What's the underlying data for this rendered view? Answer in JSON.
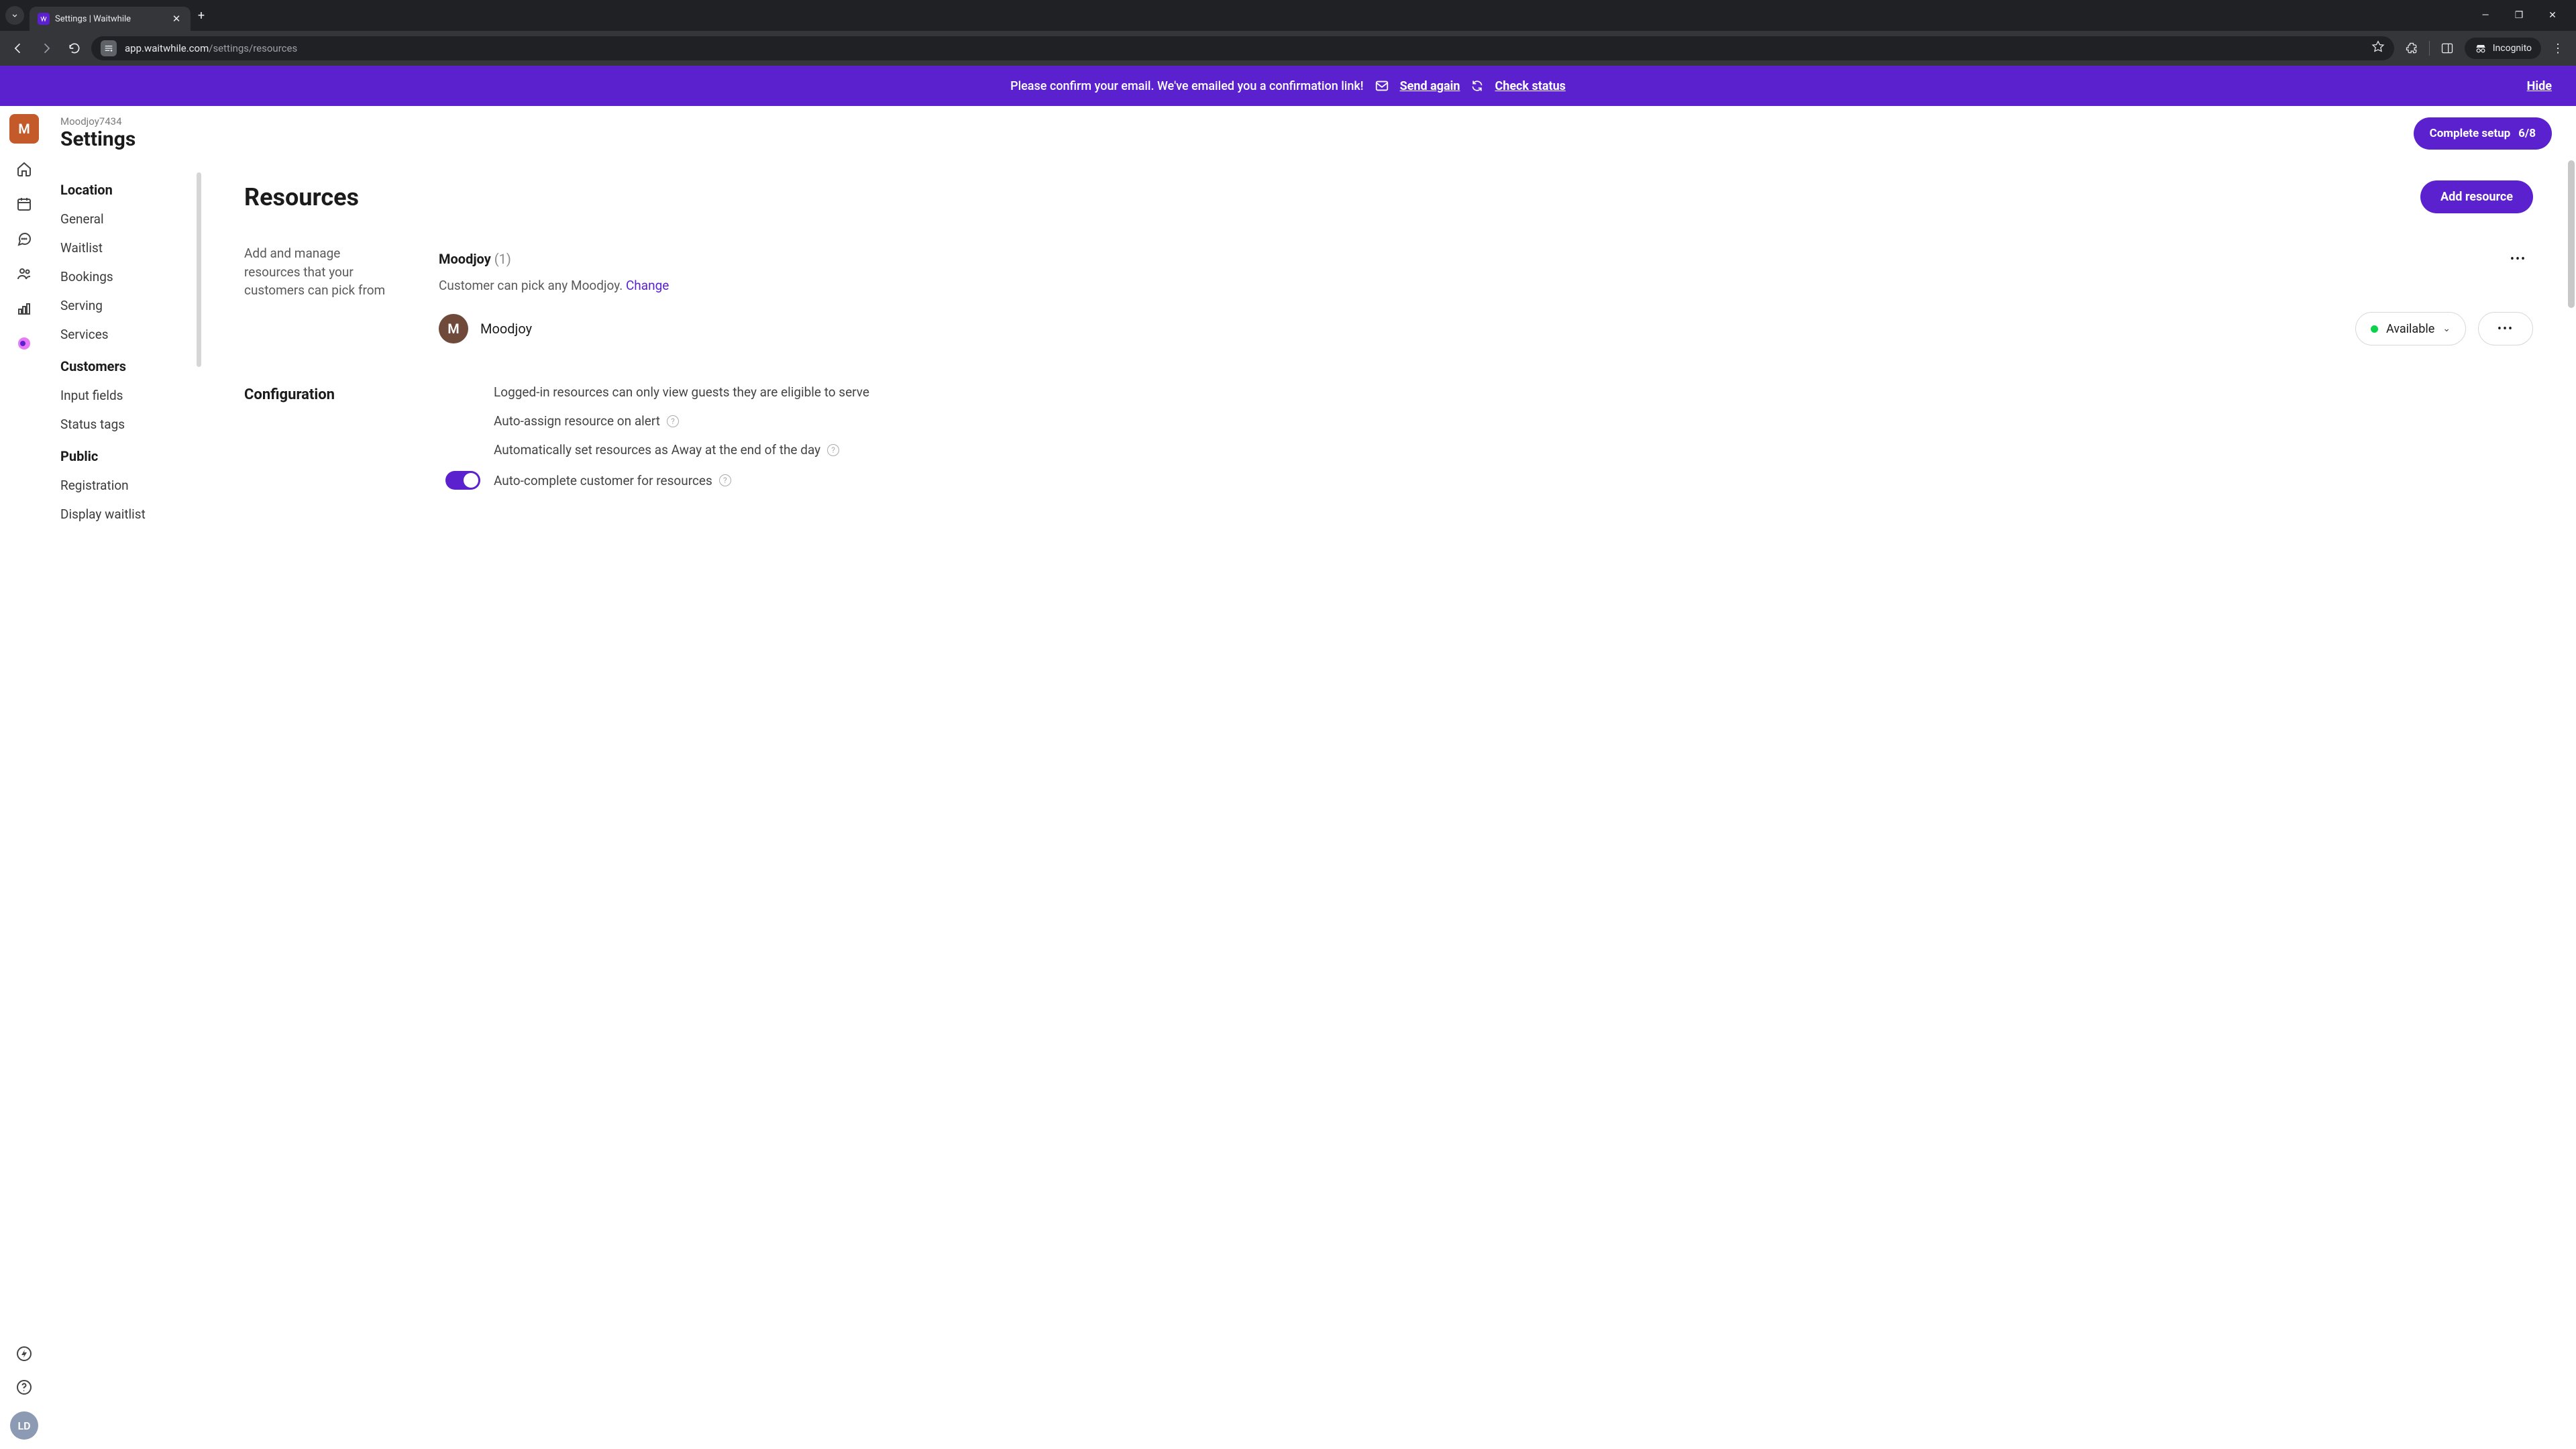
{
  "browser": {
    "tab_title": "Settings | Waitwhile",
    "url_domain": "app.waitwhile.com",
    "url_path": "/settings/resources",
    "incognito_label": "Incognito"
  },
  "banner": {
    "text": "Please confirm your email. We've emailed you a confirmation link!",
    "send_again": "Send again",
    "check_status": "Check status",
    "hide": "Hide"
  },
  "header": {
    "org": "Moodjoy7434",
    "title": "Settings",
    "setup_label": "Complete setup",
    "setup_count": "6/8",
    "org_initial": "M"
  },
  "rail": {
    "user_initials": "LD"
  },
  "sidebar": {
    "groups": [
      {
        "heading": "Location",
        "items": [
          "General",
          "Waitlist",
          "Bookings",
          "Serving",
          "Services"
        ]
      },
      {
        "heading": "Customers",
        "items": [
          "Input fields",
          "Status tags"
        ]
      },
      {
        "heading": "Public",
        "items": [
          "Registration",
          "Display waitlist"
        ]
      }
    ]
  },
  "main": {
    "title": "Resources",
    "add_button": "Add resource",
    "section_desc": "Add and manage resources that your customers can pick from",
    "group": {
      "name": "Moodjoy",
      "count": "(1)",
      "subtext": "Customer can pick any Moodjoy. ",
      "change": "Change"
    },
    "resource": {
      "initial": "M",
      "name": "Moodjoy",
      "status": "Available"
    },
    "config_heading": "Configuration",
    "config": {
      "items": [
        {
          "label": "Logged-in resources can only view guests they are eligible to serve",
          "help": false,
          "toggle": false
        },
        {
          "label": "Auto-assign resource on alert",
          "help": true,
          "toggle": false
        },
        {
          "label": "Automatically set resources as Away at the end of the day",
          "help": true,
          "toggle": false
        },
        {
          "label": "Auto-complete customer for resources",
          "help": true,
          "toggle": true
        }
      ]
    }
  }
}
